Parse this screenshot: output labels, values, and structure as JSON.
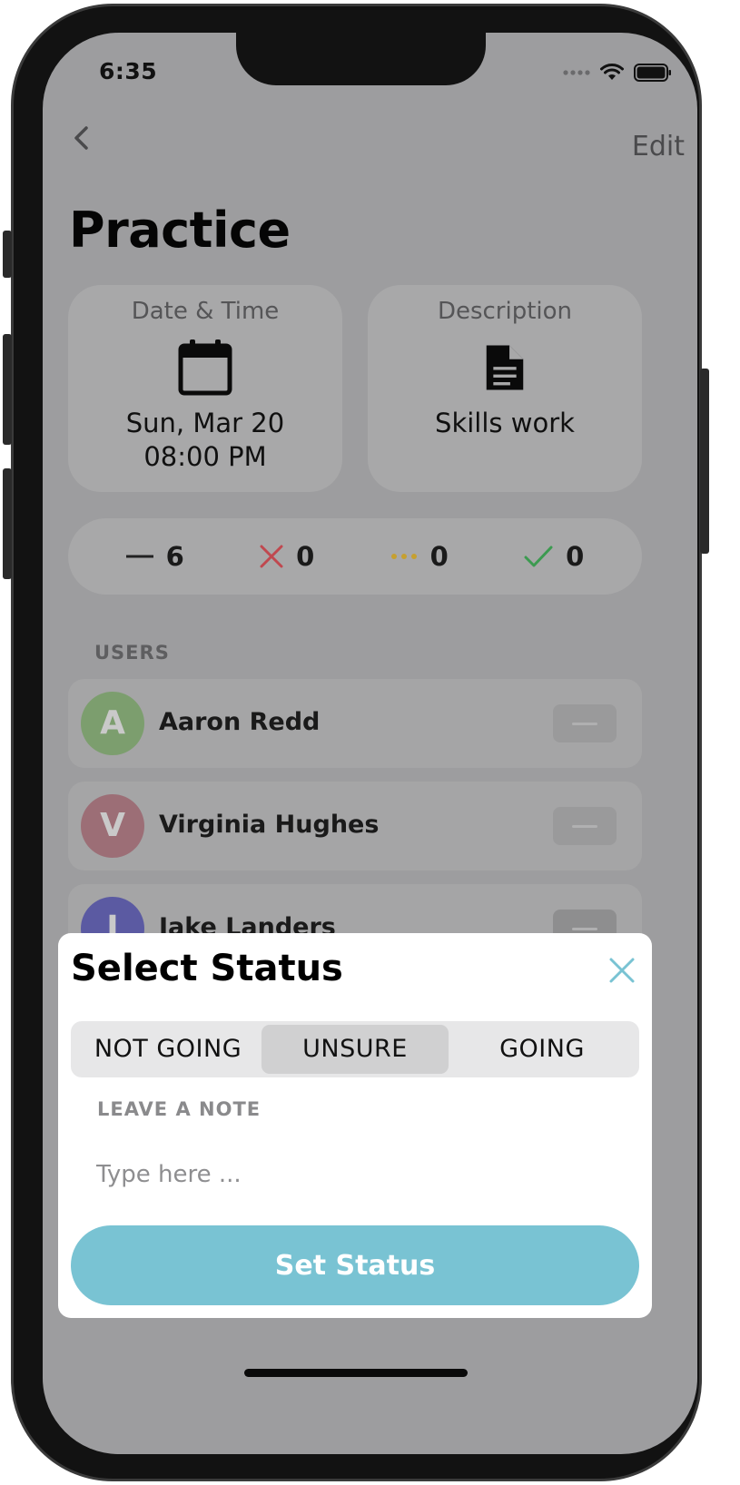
{
  "status_bar": {
    "time": "6:35",
    "icons": [
      "cellular-icon",
      "wifi-icon",
      "battery-icon"
    ]
  },
  "nav": {
    "back_icon": "chevron-left-icon",
    "edit_label": "Edit"
  },
  "page": {
    "title": "Practice"
  },
  "cards": {
    "datetime": {
      "label": "Date & Time",
      "icon": "calendar-icon",
      "line1": "Sun, Mar 20",
      "line2": "08:00 PM"
    },
    "description": {
      "label": "Description",
      "icon": "document-icon",
      "value": "Skills work"
    }
  },
  "counts": [
    {
      "icon": "dash-icon",
      "value": "6",
      "color": "#222222"
    },
    {
      "icon": "x-icon",
      "value": "0",
      "color": "#c0484f"
    },
    {
      "icon": "ellipsis-icon",
      "value": "0",
      "color": "#c6a030"
    },
    {
      "icon": "check-icon",
      "value": "0",
      "color": "#3c9a50"
    }
  ],
  "users_section": {
    "label": "USERS",
    "users": [
      {
        "initial": "A",
        "name": "Aaron Redd",
        "avatar_color": "#7c9e6e"
      },
      {
        "initial": "V",
        "name": "Virginia Hughes",
        "avatar_color": "#9c6e76"
      },
      {
        "initial": "J",
        "name": "Jake Landers",
        "avatar_color": "#5b5aa2"
      }
    ]
  },
  "sheet": {
    "title": "Select Status",
    "close_icon": "close-icon",
    "options": [
      "NOT GOING",
      "UNSURE",
      "GOING"
    ],
    "selected_option": "UNSURE",
    "note_label": "LEAVE A NOTE",
    "note_placeholder": "Type here ...",
    "note_value": "",
    "submit_label": "Set Status",
    "accent_color": "#79c3d3"
  }
}
